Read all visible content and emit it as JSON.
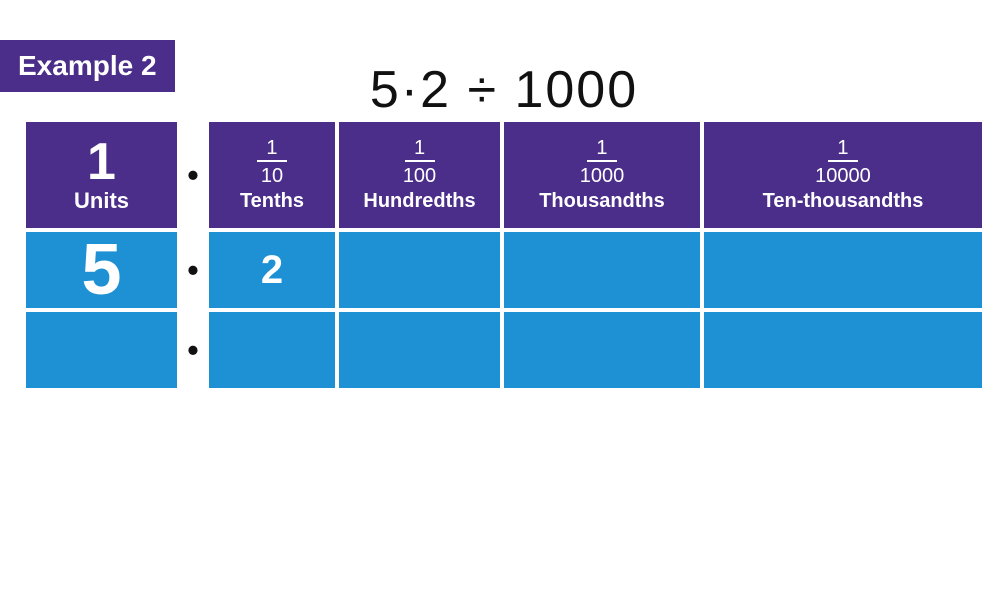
{
  "badge": {
    "text": "Example 2"
  },
  "equation": {
    "text": "5·2 ÷ 1000"
  },
  "columns": [
    {
      "id": "units",
      "fraction_top": null,
      "fraction_bottom": null,
      "label": "Units",
      "value1": "5",
      "value2": ""
    },
    {
      "id": "tenths",
      "fraction_top": "1",
      "fraction_bottom": "10",
      "label": "Tenths",
      "value1": "2",
      "value2": ""
    },
    {
      "id": "hundredths",
      "fraction_top": "1",
      "fraction_bottom": "100",
      "label": "Hundredths",
      "value1": "",
      "value2": ""
    },
    {
      "id": "thousandths",
      "fraction_top": "1",
      "fraction_bottom": "1000",
      "label": "Thousandths",
      "value1": "",
      "value2": ""
    },
    {
      "id": "ten-thousandths",
      "fraction_top": "1",
      "fraction_bottom": "10000",
      "label": "Ten-thousandths",
      "value1": "",
      "value2": ""
    }
  ],
  "dots": {
    "header": "•",
    "row1": "•",
    "row2": "•"
  }
}
